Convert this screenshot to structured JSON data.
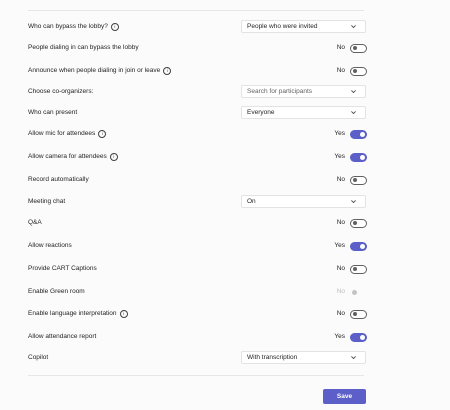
{
  "settings": [
    {
      "label": "Who can bypass the lobby?",
      "info": true,
      "control": "dropdown",
      "value": "People who were invited"
    },
    {
      "label": "People dialing in can bypass the lobby",
      "info": false,
      "control": "toggle",
      "state": "No",
      "on": false
    },
    {
      "label": "Announce when people dialing in join or leave",
      "info": true,
      "control": "toggle",
      "state": "No",
      "on": false
    },
    {
      "label": "Choose co-organizers:",
      "info": false,
      "control": "dropdown",
      "placeholder": "Search for participants"
    },
    {
      "label": "Who can present",
      "info": false,
      "control": "dropdown",
      "value": "Everyone"
    },
    {
      "label": "Allow mic for attendees",
      "info": true,
      "control": "toggle",
      "state": "Yes",
      "on": true
    },
    {
      "label": "Allow camera for attendees",
      "info": true,
      "control": "toggle",
      "state": "Yes",
      "on": true
    },
    {
      "label": "Record automatically",
      "info": false,
      "control": "toggle",
      "state": "No",
      "on": false
    },
    {
      "label": "Meeting chat",
      "info": false,
      "control": "dropdown",
      "value": "On"
    },
    {
      "label": "Q&A",
      "info": false,
      "control": "toggle",
      "state": "No",
      "on": false
    },
    {
      "label": "Allow reactions",
      "info": false,
      "control": "toggle",
      "state": "Yes",
      "on": true
    },
    {
      "label": "Provide CART Captions",
      "info": false,
      "control": "toggle",
      "state": "No",
      "on": false
    },
    {
      "label": "Enable Green room",
      "info": false,
      "control": "toggle",
      "state": "No",
      "on": false,
      "disabled": true
    },
    {
      "label": "Enable language interpretation",
      "info": true,
      "control": "toggle",
      "state": "No",
      "on": false
    },
    {
      "label": "Allow attendance report",
      "info": false,
      "control": "toggle",
      "state": "Yes",
      "on": true
    },
    {
      "label": "Copilot",
      "info": false,
      "control": "dropdown",
      "value": "With transcription"
    }
  ],
  "info_glyph": "i",
  "icons": {
    "info": "info-circle-icon",
    "chevron": "chevron-down-icon"
  },
  "colors": {
    "accent": "#5b5fc7",
    "toggle_off": "#616161",
    "disabled": "#c4c4c4"
  },
  "actions": {
    "save_label": "Save"
  }
}
